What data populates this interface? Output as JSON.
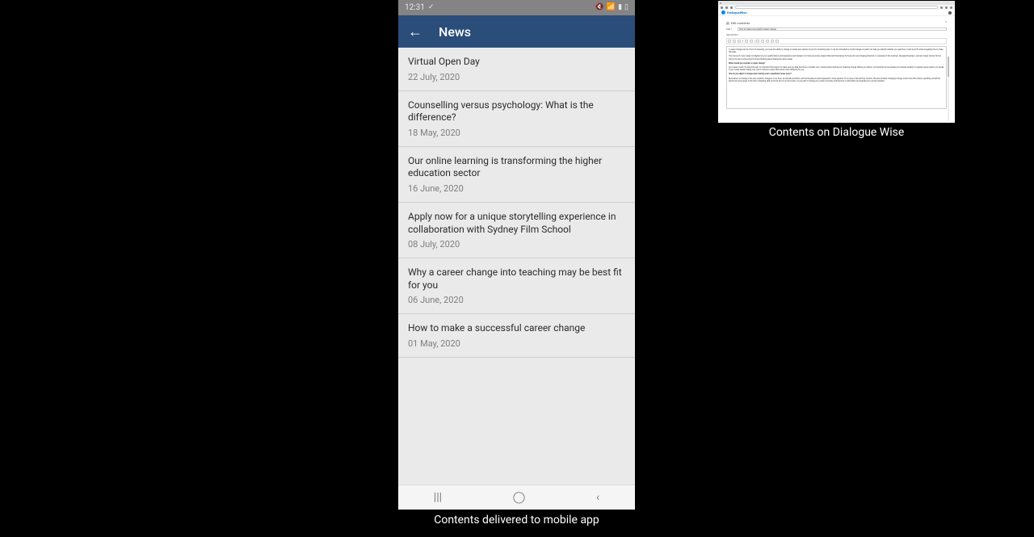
{
  "phone": {
    "status": {
      "time": "12:31",
      "check_icon": "✓",
      "mute_icon": "🔇",
      "wifi_icon": "📶",
      "signal_icon": "▮",
      "battery_icon": "▯"
    },
    "app_bar": {
      "back_arrow": "←",
      "title": "News"
    },
    "items": [
      {
        "title": "Virtual Open Day",
        "date": "22 July, 2020"
      },
      {
        "title": "Counselling versus psychology: What is the difference?",
        "date": "18 May, 2020"
      },
      {
        "title": "Our online learning is transforming the higher education sector",
        "date": "16 June, 2020"
      },
      {
        "title": "Apply now for a unique storytelling experience in collaboration with Sydney Film School",
        "date": "08 July, 2020"
      },
      {
        "title": "Why a career change into teaching may be best fit for you",
        "date": "06 June, 2020"
      },
      {
        "title": "How to make a successful career change",
        "date": "01 May, 2020"
      }
    ],
    "nav": {
      "recent": "|||",
      "home": "◯",
      "back": "‹"
    },
    "caption": "Contents delivered to mobile app"
  },
  "browser": {
    "brand": "DialogueWise",
    "panel_title": "Edit contents",
    "close_icon": "×",
    "form": {
      "title_label": "title *",
      "title_value": "How to make a successful career change",
      "description_label": "description"
    },
    "body": {
      "p1": "A career change can be a form of necessity; you have the ability to change or realise new options to pivot to something else. It can be motivated by a bold change our paths can help you identify whether you need the or want to profit while navigating how to make the leaps.",
      "p2": "The choice of a new career will depend on your qualifications, and experience and interests. For there are some, present that lend themselves to those who are changing direction, or ourselves in this instance. We asked business. Lecturer Career Advisor Simon Francis to give out the advice to those thinking about making the same career.",
      "h1": "When should you consider a career change?",
      "p3": "As a career coach: It's about the pull. An important first step is to make sure you take the time to consider your current position before you make the change. Before you intend, it is important to re-evaluate your present situation; to explore career options; to decide if your career needs making over; and to choose a career that will be most satisfying for you.",
      "h2": "How do you adjust to change when starting such a significant career move?",
      "p4": "Be positive: as change is the only constant; change is in our lives. As humans evolution, we'll hit the places where represent in many aspects of our lives or the last four months. We have all been managing change; some more than others, upsetting carried the brand new living space in the form of keeping safe at school and on on the screen. As you plan to change your career concisely, look the time or self-reflect and evaluate your current situation."
    },
    "caption": "Contents on Dialogue Wise"
  }
}
